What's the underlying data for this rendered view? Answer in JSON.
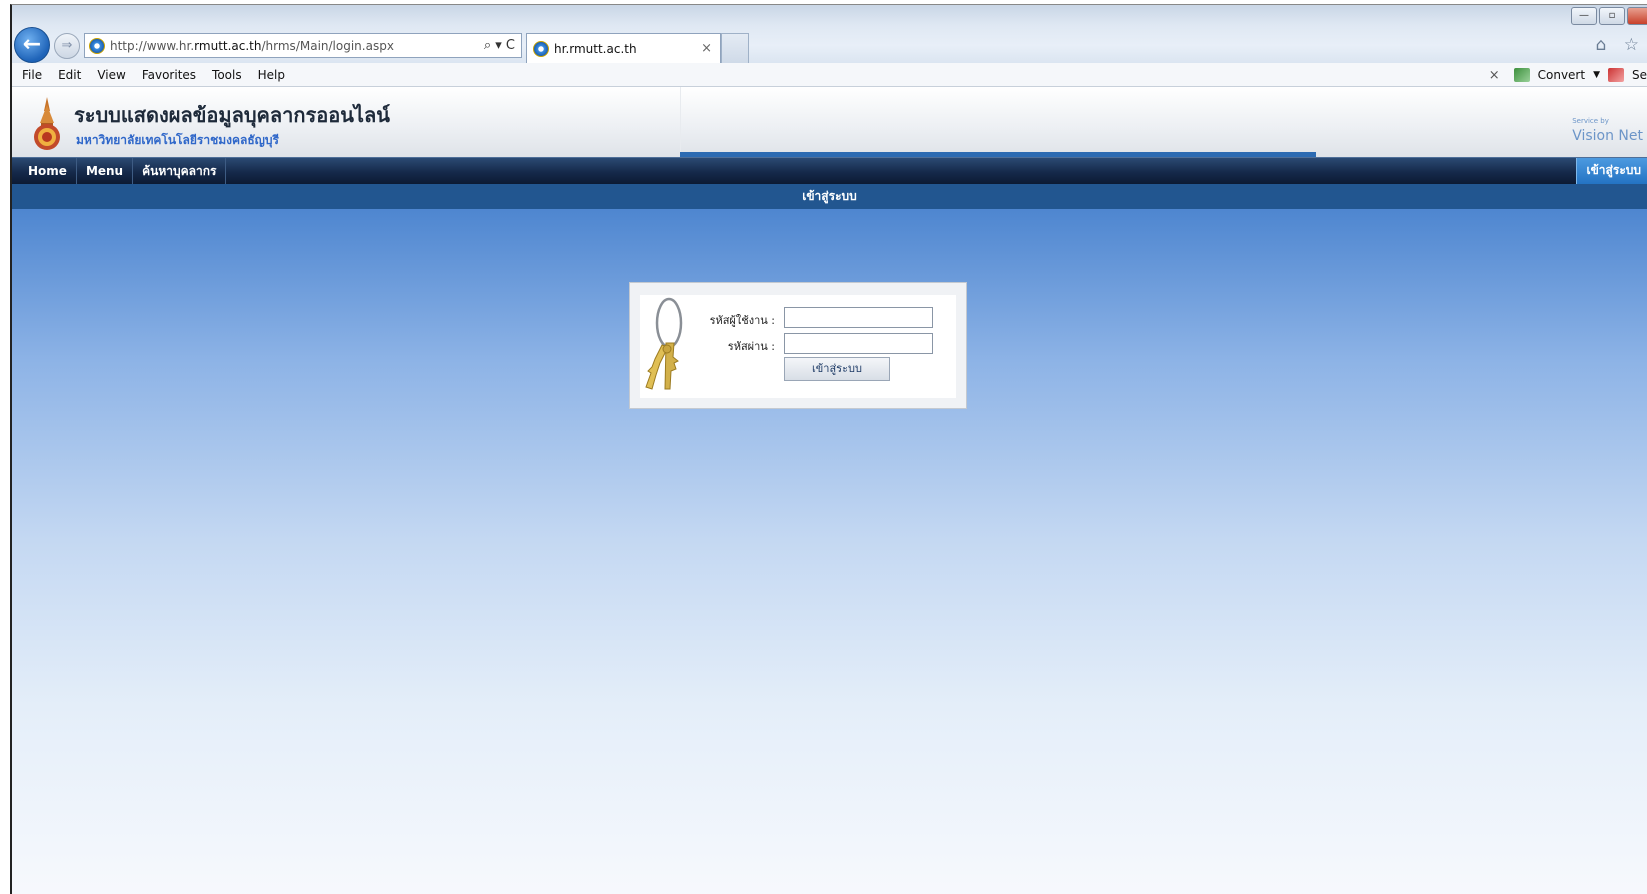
{
  "browser": {
    "address_prefix": "http://www.hr.",
    "address_domain": "rmutt.ac.th",
    "address_path": "/hrms/Main/login.aspx",
    "address_tools": "⌕ ▾ C",
    "tab_title": "hr.rmutt.ac.th",
    "tab_close": "×",
    "menu": [
      "File",
      "Edit",
      "View",
      "Favorites",
      "Tools",
      "Help"
    ],
    "convert_label": "Convert",
    "convert_dropdown": "▼",
    "select_label": "Se",
    "command_close": "×",
    "back_glyph": "←",
    "forward_glyph": "⇒",
    "right_icons": "⌂ ☆",
    "win_controls": [
      "—",
      "▫",
      ""
    ]
  },
  "site": {
    "title": "ระบบแสดงผลข้อมูลบุคลากรออนไลน์",
    "subtitle": "มหาวิทยาลัยเทคโนโลยีราชมงคลธัญบุรี",
    "service_small": "Service by",
    "service_brand": "Vision Net",
    "nav": [
      "Home",
      "Menu",
      "ค้นหาบุคลากร"
    ],
    "nav_login": "เข้าสู่ระบบ",
    "page_heading": "เข้าสู่ระบบ"
  },
  "login": {
    "username_label": "รหัสผู้ใช้งาน :",
    "password_label": "รหัสผ่าน :",
    "username_value": "",
    "password_value": "",
    "submit_label": "เข้าสู่ระบบ"
  },
  "colors": {
    "nav_dark": "#15294a",
    "heading_bar": "#225690",
    "accent_blue": "#2c6bb2",
    "content_top": "#4e86d0"
  }
}
